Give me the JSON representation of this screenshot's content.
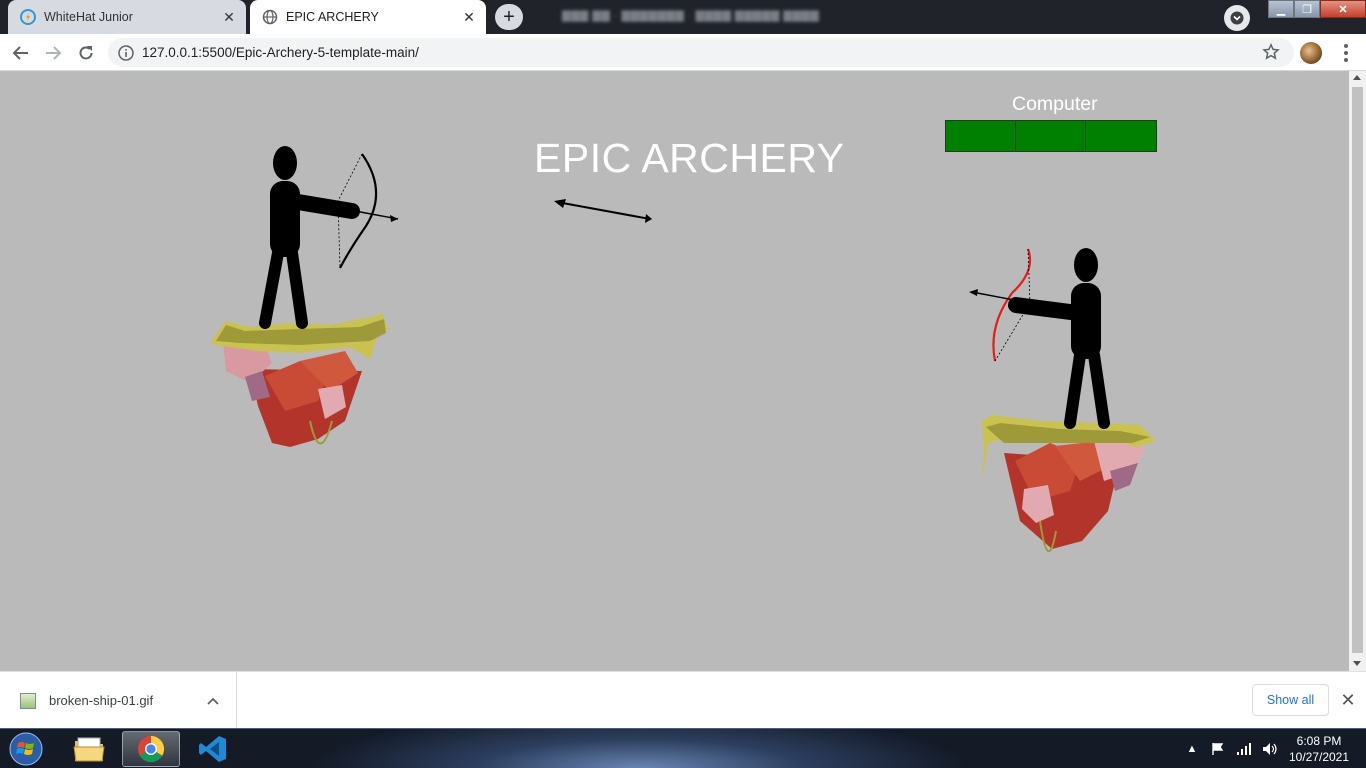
{
  "browser": {
    "tabs": [
      {
        "title": "WhiteHat Junior",
        "active": false,
        "icon": "whitehat-favicon"
      },
      {
        "title": "EPIC ARCHERY",
        "active": true,
        "icon": "globe-icon"
      }
    ],
    "url": "127.0.0.1:5500/Epic-Archery-5-template-main/"
  },
  "game": {
    "title": "EPIC ARCHERY",
    "computer_label": "Computer",
    "computer_health_segments": 3,
    "health_color": "#008000",
    "background_color": "#bababa"
  },
  "downloads": {
    "file_name": "broken-ship-01.gif",
    "show_all_label": "Show all"
  },
  "taskbar": {
    "time": "6:08 PM",
    "date": "10/27/2021",
    "apps": [
      "start-orb",
      "file-explorer-icon",
      "chrome-icon",
      "vscode-icon"
    ]
  }
}
